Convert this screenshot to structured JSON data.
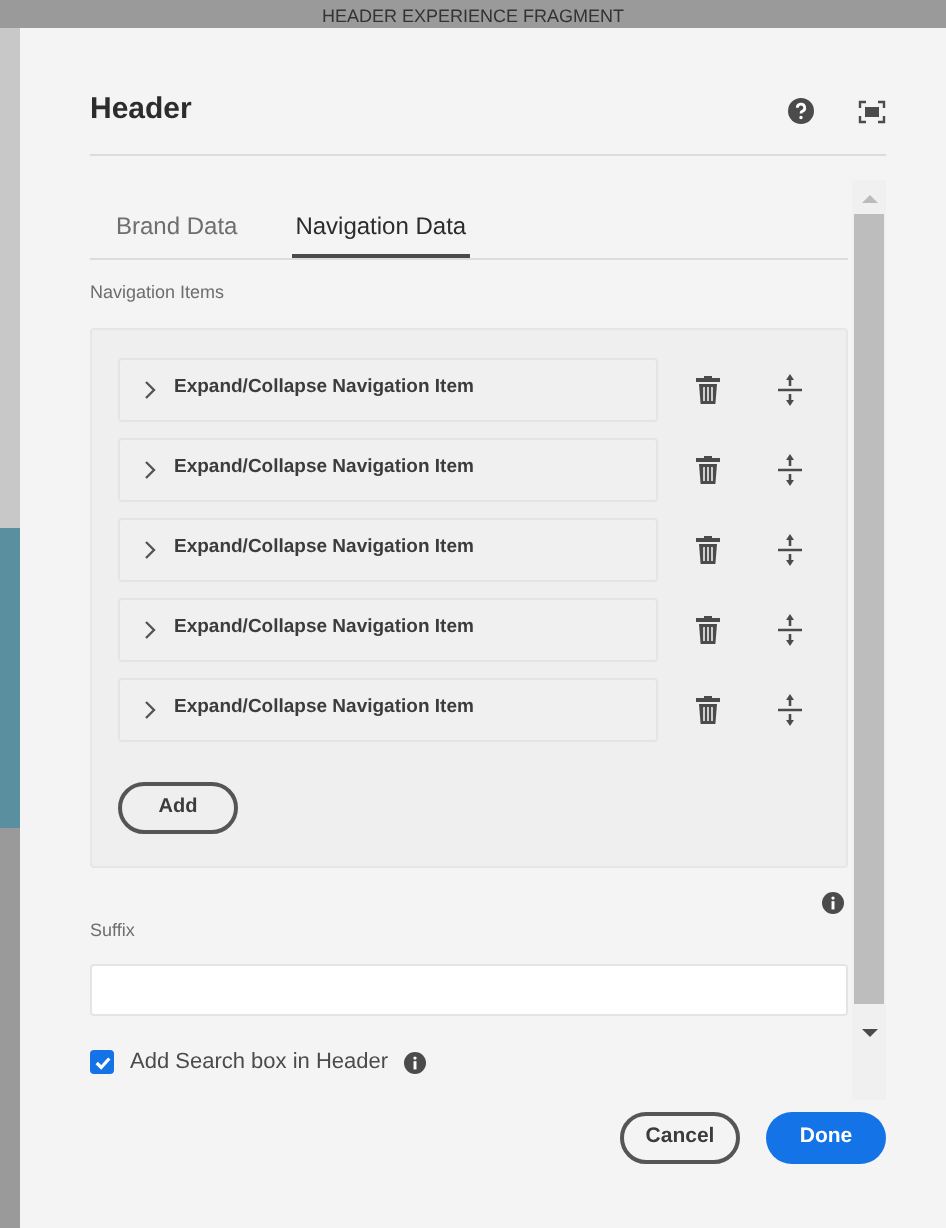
{
  "background": {
    "title": "HEADER EXPERIENCE FRAGMENT"
  },
  "dialog": {
    "title": "Header",
    "tabs": [
      {
        "label": "Brand Data",
        "selected": false
      },
      {
        "label": "Navigation Data",
        "selected": true
      }
    ],
    "navigation": {
      "label": "Navigation Items",
      "items": [
        {
          "label": "Expand/Collapse Navigation Item",
          "expanded": false
        },
        {
          "label": "Expand/Collapse Navigation Item",
          "expanded": false
        },
        {
          "label": "Expand/Collapse Navigation Item",
          "expanded": false
        },
        {
          "label": "Expand/Collapse Navigation Item",
          "expanded": false
        },
        {
          "label": "Expand/Collapse Navigation Item",
          "expanded": false
        }
      ],
      "add_button": "Add"
    },
    "suffix": {
      "label": "Suffix"
    },
    "search_checkbox": {
      "label": "Add Search box in Header",
      "checked": true
    },
    "buttons": {
      "cancel": "Cancel",
      "done": "Done"
    }
  }
}
